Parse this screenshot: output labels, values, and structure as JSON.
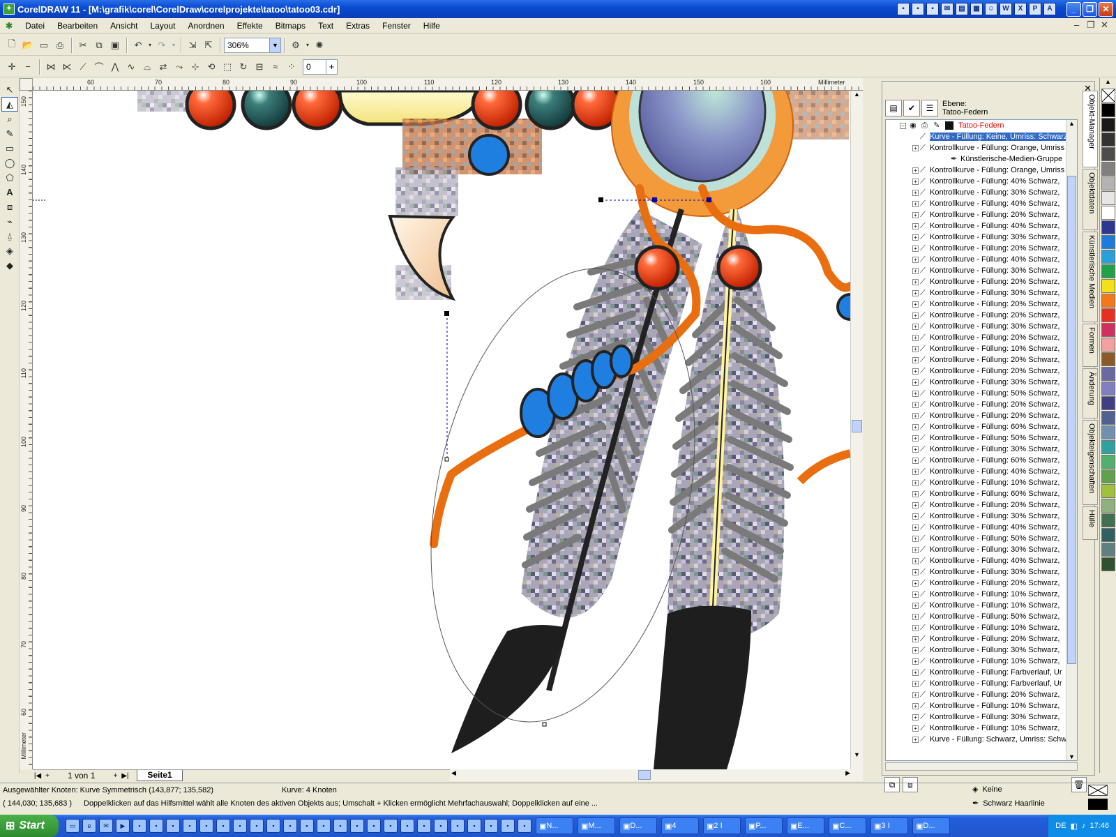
{
  "window": {
    "title": "CorelDRAW 11 - [M:\\grafik\\corel\\CorelDraw\\corelprojekte\\tatoo\\tatoo03.cdr]",
    "controls": [
      "_",
      "❐",
      "✕"
    ]
  },
  "menu": [
    "Datei",
    "Bearbeiten",
    "Ansicht",
    "Layout",
    "Anordnen",
    "Effekte",
    "Bitmaps",
    "Text",
    "Extras",
    "Fenster",
    "Hilfe"
  ],
  "toolbar": {
    "zoom": "306%"
  },
  "propertybar": {
    "value": "0"
  },
  "ruler": {
    "unit": "Millimeter",
    "h_ticks": [
      "60",
      "70",
      "80",
      "90",
      "100",
      "110",
      "120",
      "130",
      "140",
      "150",
      "160"
    ],
    "v_ticks": [
      "150",
      "140",
      "130",
      "120",
      "110",
      "100",
      "90",
      "80",
      "70",
      "60"
    ]
  },
  "pagebar": {
    "counter": "1 von 1",
    "tab": "Seite1"
  },
  "docker": {
    "layer_label": "Ebene:",
    "layer_name": "Tatoo-Federn",
    "layer_root": "Tatoo-Federn",
    "rows": [
      {
        "text": "Kurve - Füllung: Keine, Umriss: Schwarz",
        "indent": 1,
        "selected": true
      },
      {
        "text": "Kontrollkurve - Füllung: Orange, Umriss",
        "indent": 1,
        "selected": false
      },
      {
        "text": "Künstlerische-Medien-Gruppe",
        "indent": 2,
        "selected": false
      },
      {
        "text": "Kontrollkurve - Füllung: Orange, Umriss",
        "indent": 1,
        "selected": false
      },
      {
        "text": "Kontrollkurve - Füllung: 40% Schwarz,",
        "indent": 1,
        "selected": false
      },
      {
        "text": "Kontrollkurve - Füllung: 30% Schwarz,",
        "indent": 1,
        "selected": false
      },
      {
        "text": "Kontrollkurve - Füllung: 40% Schwarz,",
        "indent": 1,
        "selected": false
      },
      {
        "text": "Kontrollkurve - Füllung: 20% Schwarz,",
        "indent": 1,
        "selected": false
      },
      {
        "text": "Kontrollkurve - Füllung: 40% Schwarz,",
        "indent": 1,
        "selected": false
      },
      {
        "text": "Kontrollkurve - Füllung: 30% Schwarz,",
        "indent": 1,
        "selected": false
      },
      {
        "text": "Kontrollkurve - Füllung: 20% Schwarz,",
        "indent": 1,
        "selected": false
      },
      {
        "text": "Kontrollkurve - Füllung: 40% Schwarz,",
        "indent": 1,
        "selected": false
      },
      {
        "text": "Kontrollkurve - Füllung: 30% Schwarz,",
        "indent": 1,
        "selected": false
      },
      {
        "text": "Kontrollkurve - Füllung: 20% Schwarz,",
        "indent": 1,
        "selected": false
      },
      {
        "text": "Kontrollkurve - Füllung: 30% Schwarz,",
        "indent": 1,
        "selected": false
      },
      {
        "text": "Kontrollkurve - Füllung: 20% Schwarz,",
        "indent": 1,
        "selected": false
      },
      {
        "text": "Kontrollkurve - Füllung: 20% Schwarz,",
        "indent": 1,
        "selected": false
      },
      {
        "text": "Kontrollkurve - Füllung: 30% Schwarz,",
        "indent": 1,
        "selected": false
      },
      {
        "text": "Kontrollkurve - Füllung: 20% Schwarz,",
        "indent": 1,
        "selected": false
      },
      {
        "text": "Kontrollkurve - Füllung: 10% Schwarz,",
        "indent": 1,
        "selected": false
      },
      {
        "text": "Kontrollkurve - Füllung: 20% Schwarz,",
        "indent": 1,
        "selected": false
      },
      {
        "text": "Kontrollkurve - Füllung: 20% Schwarz,",
        "indent": 1,
        "selected": false
      },
      {
        "text": "Kontrollkurve - Füllung: 30% Schwarz,",
        "indent": 1,
        "selected": false
      },
      {
        "text": "Kontrollkurve - Füllung: 50% Schwarz,",
        "indent": 1,
        "selected": false
      },
      {
        "text": "Kontrollkurve - Füllung: 20% Schwarz,",
        "indent": 1,
        "selected": false
      },
      {
        "text": "Kontrollkurve - Füllung: 20% Schwarz,",
        "indent": 1,
        "selected": false
      },
      {
        "text": "Kontrollkurve - Füllung: 60% Schwarz,",
        "indent": 1,
        "selected": false
      },
      {
        "text": "Kontrollkurve - Füllung: 50% Schwarz,",
        "indent": 1,
        "selected": false
      },
      {
        "text": "Kontrollkurve - Füllung: 30% Schwarz,",
        "indent": 1,
        "selected": false
      },
      {
        "text": "Kontrollkurve - Füllung: 60% Schwarz,",
        "indent": 1,
        "selected": false
      },
      {
        "text": "Kontrollkurve - Füllung: 40% Schwarz,",
        "indent": 1,
        "selected": false
      },
      {
        "text": "Kontrollkurve - Füllung: 10% Schwarz,",
        "indent": 1,
        "selected": false
      },
      {
        "text": "Kontrollkurve - Füllung: 60% Schwarz,",
        "indent": 1,
        "selected": false
      },
      {
        "text": "Kontrollkurve - Füllung: 20% Schwarz,",
        "indent": 1,
        "selected": false
      },
      {
        "text": "Kontrollkurve - Füllung: 30% Schwarz,",
        "indent": 1,
        "selected": false
      },
      {
        "text": "Kontrollkurve - Füllung: 40% Schwarz,",
        "indent": 1,
        "selected": false
      },
      {
        "text": "Kontrollkurve - Füllung: 50% Schwarz,",
        "indent": 1,
        "selected": false
      },
      {
        "text": "Kontrollkurve - Füllung: 30% Schwarz,",
        "indent": 1,
        "selected": false
      },
      {
        "text": "Kontrollkurve - Füllung: 40% Schwarz,",
        "indent": 1,
        "selected": false
      },
      {
        "text": "Kontrollkurve - Füllung: 30% Schwarz,",
        "indent": 1,
        "selected": false
      },
      {
        "text": "Kontrollkurve - Füllung: 20% Schwarz,",
        "indent": 1,
        "selected": false
      },
      {
        "text": "Kontrollkurve - Füllung: 10% Schwarz,",
        "indent": 1,
        "selected": false
      },
      {
        "text": "Kontrollkurve - Füllung: 10% Schwarz,",
        "indent": 1,
        "selected": false
      },
      {
        "text": "Kontrollkurve - Füllung: 50% Schwarz,",
        "indent": 1,
        "selected": false
      },
      {
        "text": "Kontrollkurve - Füllung: 10% Schwarz,",
        "indent": 1,
        "selected": false
      },
      {
        "text": "Kontrollkurve - Füllung: 20% Schwarz,",
        "indent": 1,
        "selected": false
      },
      {
        "text": "Kontrollkurve - Füllung: 30% Schwarz,",
        "indent": 1,
        "selected": false
      },
      {
        "text": "Kontrollkurve - Füllung: 10% Schwarz,",
        "indent": 1,
        "selected": false
      },
      {
        "text": "Kontrollkurve - Füllung: Farbverlauf, Ur",
        "indent": 1,
        "selected": false
      },
      {
        "text": "Kontrollkurve - Füllung: Farbverlauf, Ur",
        "indent": 1,
        "selected": false
      },
      {
        "text": "Kontrollkurve - Füllung: 20% Schwarz,",
        "indent": 1,
        "selected": false
      },
      {
        "text": "Kontrollkurve - Füllung: 10% Schwarz,",
        "indent": 1,
        "selected": false
      },
      {
        "text": "Kontrollkurve - Füllung: 30% Schwarz,",
        "indent": 1,
        "selected": false
      },
      {
        "text": "Kontrollkurve - Füllung: 10% Schwarz,",
        "indent": 1,
        "selected": false
      },
      {
        "text": "Kurve - Füllung: Schwarz, Umriss: Schw",
        "indent": 1,
        "selected": false
      }
    ]
  },
  "docker_tabs": [
    "Objekt-Manager",
    "Objektdaten",
    "Künstlerische Medien",
    "Formen",
    "Änderung",
    "Objekteigenschaften",
    "Hülle"
  ],
  "palette": [
    "#ffffff",
    "#000000",
    "#1a1a1a",
    "#333333",
    "#4d4d4d",
    "#808080",
    "#b3b3b3",
    "#e6e6e6",
    "#ffffff",
    "#2b3a8c",
    "#1f7ad9",
    "#2aa0d8",
    "#22a04a",
    "#f2e01a",
    "#f2781a",
    "#e83020",
    "#d03060",
    "#f2a0a0",
    "#8a5a2a",
    "#6a6aa0",
    "#8080c0",
    "#404080",
    "#506090",
    "#7090b0",
    "#30a0a0",
    "#50b070",
    "#60a050",
    "#a0c040",
    "#90b080",
    "#407050",
    "#306060",
    "#608080",
    "#305030"
  ],
  "status": {
    "line1_left": "Ausgewählter Knoten: Kurve Symmetrisch (143,877; 135,582)",
    "line1_mid": "Kurve: 4 Knoten",
    "line2_left": "( 144,030; 135,683 )",
    "line2_mid": "Doppelklicken auf das Hilfsmittel wählt alle Knoten des aktiven Objekts aus; Umschalt + Klicken ermöglicht Mehrfachauswahl; Doppelklicken auf eine ...",
    "fill": "Keine",
    "outline": "Schwarz Haarlinie"
  },
  "taskbar": {
    "start": "Start",
    "tasks": [
      "N...",
      "M...",
      "D...",
      "4",
      "2 I",
      "P...",
      "E...",
      "C...",
      "3 I",
      "D..."
    ],
    "lang": "DE",
    "clock": "17:46"
  }
}
